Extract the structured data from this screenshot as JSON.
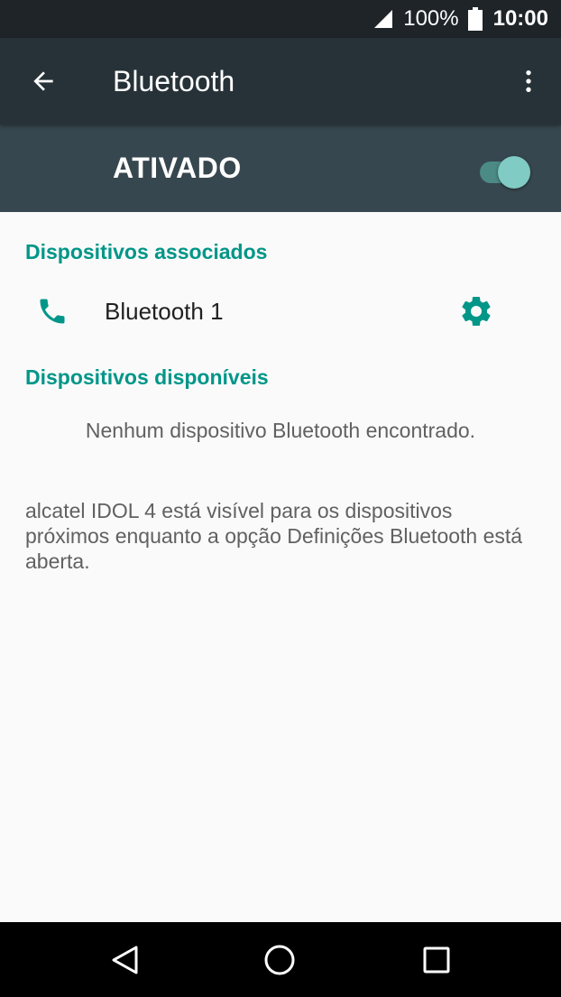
{
  "status_bar": {
    "battery_percent": "100%",
    "time": "10:00",
    "icons": [
      "signal-icon",
      "battery-icon"
    ]
  },
  "toolbar": {
    "title": "Bluetooth",
    "icons": [
      "back-arrow-icon",
      "more-vert-icon"
    ]
  },
  "bluetooth_switch": {
    "label": "ATIVADO",
    "on": true
  },
  "paired_section": {
    "header": "Dispositivos associados",
    "devices": [
      {
        "name": "Bluetooth 1",
        "icon": "phone-icon",
        "action_icon": "gear-icon"
      }
    ]
  },
  "available_section": {
    "header": "Dispositivos disponíveis",
    "empty_message": "Nenhum dispositivo Bluetooth encontrado."
  },
  "visibility_note": "alcatel IDOL 4 está visível para os dispositivos próximos enquanto a opção Definições Bluetooth está aberta.",
  "nav_bar": {
    "icons": [
      "back-triangle-icon",
      "home-circle-icon",
      "recents-square-icon"
    ]
  },
  "colors": {
    "accent": "#009688",
    "toolbar": "#263238",
    "switch_bar": "#37474f",
    "status_bar": "#1e2428"
  }
}
